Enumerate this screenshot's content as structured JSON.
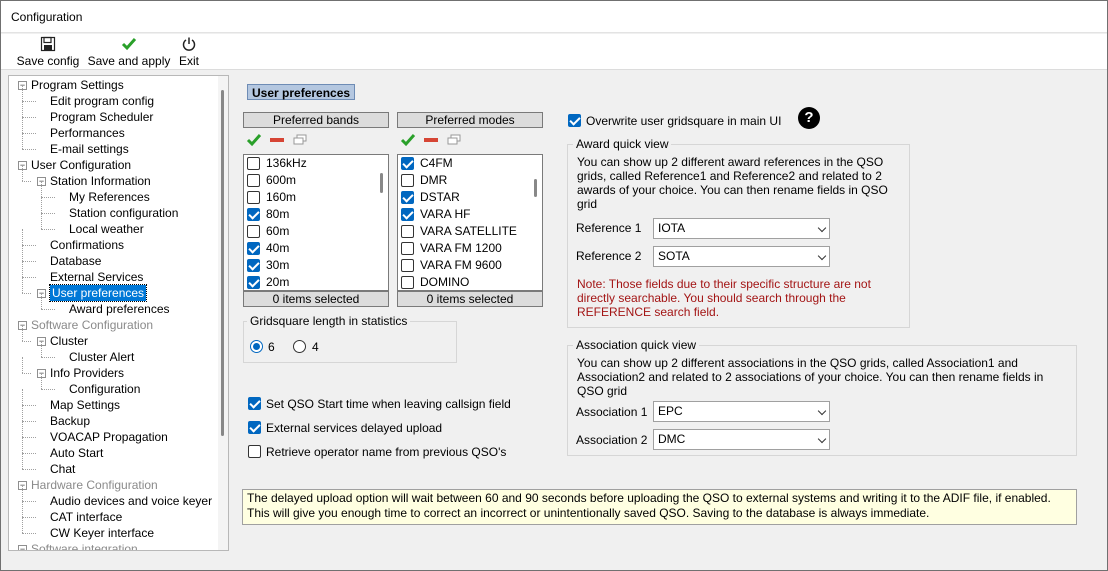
{
  "window": {
    "title": "Configuration"
  },
  "toolbar": {
    "save_config": "Save config",
    "save_apply": "Save and apply",
    "exit": "Exit"
  },
  "tree": [
    {
      "label": "Program Settings",
      "level": 0,
      "toggle": "−",
      "gray": false
    },
    {
      "label": "Edit program config",
      "level": 1
    },
    {
      "label": "Program Scheduler",
      "level": 1
    },
    {
      "label": "Performances",
      "level": 1
    },
    {
      "label": "E-mail settings",
      "level": 1
    },
    {
      "label": "User Configuration",
      "level": 0,
      "toggle": "−",
      "gray": false
    },
    {
      "label": "Station Information",
      "level": 1,
      "toggle": "−"
    },
    {
      "label": "My References",
      "level": 2
    },
    {
      "label": "Station configuration",
      "level": 2
    },
    {
      "label": "Local weather",
      "level": 2
    },
    {
      "label": "Confirmations",
      "level": 1
    },
    {
      "label": "Database",
      "level": 1
    },
    {
      "label": "External Services",
      "level": 1
    },
    {
      "label": "User preferences",
      "level": 1,
      "toggle": "−",
      "selected": true
    },
    {
      "label": "Award preferences",
      "level": 2
    },
    {
      "label": "Software Configuration",
      "level": 0,
      "toggle": "−",
      "gray": true
    },
    {
      "label": "Cluster",
      "level": 1,
      "toggle": "−"
    },
    {
      "label": "Cluster Alert",
      "level": 2
    },
    {
      "label": "Info Providers",
      "level": 1,
      "toggle": "−"
    },
    {
      "label": "Configuration",
      "level": 2
    },
    {
      "label": "Map Settings",
      "level": 1
    },
    {
      "label": "Backup",
      "level": 1
    },
    {
      "label": "VOACAP Propagation",
      "level": 1
    },
    {
      "label": "Auto Start",
      "level": 1
    },
    {
      "label": "Chat",
      "level": 1
    },
    {
      "label": "Hardware Configuration",
      "level": 0,
      "toggle": "−",
      "gray": true
    },
    {
      "label": "Audio devices and voice keyer",
      "level": 1
    },
    {
      "label": "CAT interface",
      "level": 1
    },
    {
      "label": "CW Keyer interface",
      "level": 1
    },
    {
      "label": "Software integration",
      "level": 0,
      "toggle": "−",
      "gray": true
    }
  ],
  "section_title": "User preferences",
  "bands": {
    "header": "Preferred bands",
    "footer": "0 items selected",
    "items": [
      {
        "label": "136kHz",
        "checked": false
      },
      {
        "label": "600m",
        "checked": false
      },
      {
        "label": "160m",
        "checked": false
      },
      {
        "label": "80m",
        "checked": true
      },
      {
        "label": "60m",
        "checked": false
      },
      {
        "label": "40m",
        "checked": true
      },
      {
        "label": "30m",
        "checked": true
      },
      {
        "label": "20m",
        "checked": true
      }
    ]
  },
  "modes": {
    "header": "Preferred modes",
    "footer": "0 items selected",
    "items": [
      {
        "label": "C4FM",
        "checked": true
      },
      {
        "label": "DMR",
        "checked": false
      },
      {
        "label": "DSTAR",
        "checked": true
      },
      {
        "label": "VARA HF",
        "checked": true
      },
      {
        "label": "VARA SATELLITE",
        "checked": false
      },
      {
        "label": "VARA FM 1200",
        "checked": false
      },
      {
        "label": "VARA FM 9600",
        "checked": false
      },
      {
        "label": "DOMINO",
        "checked": false
      }
    ]
  },
  "gridsquare": {
    "title": "Gridsquare length in statistics",
    "opt6": "6",
    "opt4": "4",
    "selected": "6"
  },
  "options": [
    {
      "label": "Set QSO Start time when leaving callsign field",
      "checked": true
    },
    {
      "label": "External services delayed upload",
      "checked": true
    },
    {
      "label": "Retrieve operator name from previous QSO's",
      "checked": false
    }
  ],
  "overwrite": {
    "label": "Overwrite user gridsquare in main UI",
    "checked": true
  },
  "award": {
    "title": "Award quick view",
    "desc": "You can show up 2 different award references in the QSO grids, called Reference1 and Reference2 and related to 2 awards of your choice. You can then rename fields in QSO grid",
    "ref1_label": "Reference 1",
    "ref1_value": "IOTA",
    "ref2_label": "Reference 2",
    "ref2_value": "SOTA",
    "note": "Note: Those fields due to their specific structure are not directly searchable. You should search through the REFERENCE search field."
  },
  "assoc": {
    "title": "Association quick view",
    "desc": "You can show up 2 different associations in the QSO grids, called Association1 and Association2 and related to 2 associations of your choice. You can then rename fields in QSO grid",
    "a1_label": "Association 1",
    "a1_value": "EPC",
    "a2_label": "Association 2",
    "a2_value": "DMC"
  },
  "info": "The delayed upload option will wait between 60 and 90 seconds before uploading the QSO to external systems and writing it to the ADIF file, if enabled. This will give you enough time to correct an incorrect or unintentionally saved QSO. Saving to the database is always immediate.",
  "colors": {
    "accent": "#0067c0",
    "selection": "#0078d7",
    "note": "#a31515",
    "info_bg": "#ffffe1",
    "section_bg": "#b4c7e0"
  }
}
